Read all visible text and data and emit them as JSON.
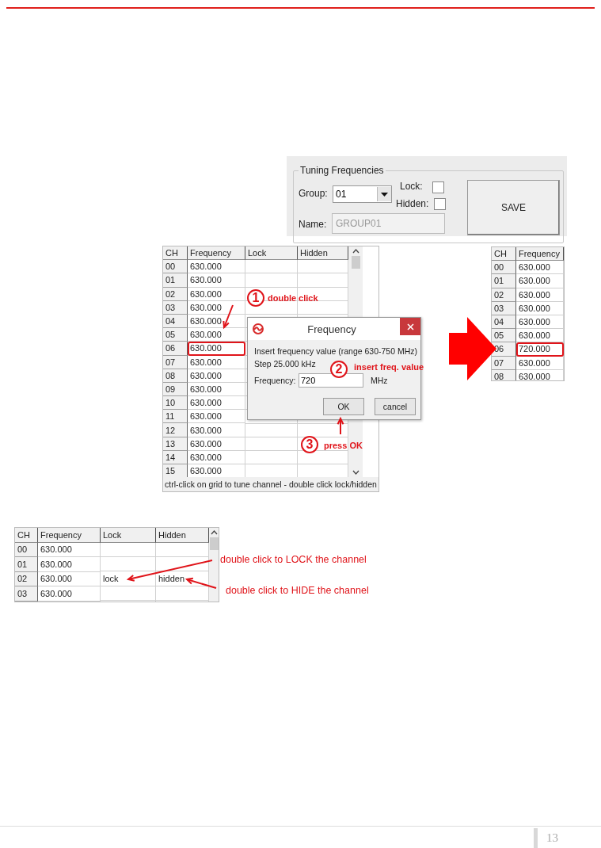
{
  "settings_panel": {
    "title": "Tuning Frequencies",
    "group_label": "Group:",
    "group_value": "01",
    "lock_label": "Lock:",
    "lock_checked": false,
    "hidden_label": "Hidden:",
    "hidden_checked": false,
    "name_label": "Name:",
    "name_value": "GROUP01",
    "save_button": "SAVE"
  },
  "channel_grid": {
    "columns": [
      "CH",
      "Frequency",
      "Lock",
      "Hidden"
    ],
    "rows": [
      {
        "ch": "00",
        "frequency": "630.000",
        "highlighted": false
      },
      {
        "ch": "01",
        "frequency": "630.000",
        "highlighted": false
      },
      {
        "ch": "02",
        "frequency": "630.000",
        "highlighted": false
      },
      {
        "ch": "03",
        "frequency": "630.000",
        "highlighted": false
      },
      {
        "ch": "04",
        "frequency": "630.000",
        "highlighted": false
      },
      {
        "ch": "05",
        "frequency": "630.000",
        "highlighted": false
      },
      {
        "ch": "06",
        "frequency": "630.000",
        "highlighted": true
      },
      {
        "ch": "07",
        "frequency": "630.000",
        "highlighted": false
      },
      {
        "ch": "08",
        "frequency": "630.000",
        "highlighted": false
      },
      {
        "ch": "09",
        "frequency": "630.000",
        "highlighted": false
      },
      {
        "ch": "10",
        "frequency": "630.000",
        "highlighted": false
      },
      {
        "ch": "11",
        "frequency": "630.000",
        "highlighted": false
      },
      {
        "ch": "12",
        "frequency": "630.000",
        "highlighted": false
      },
      {
        "ch": "13",
        "frequency": "630.000",
        "highlighted": false
      },
      {
        "ch": "14",
        "frequency": "630.000",
        "highlighted": false
      },
      {
        "ch": "15",
        "frequency": "630.000",
        "highlighted": false
      }
    ],
    "status": "ctrl-click on grid to tune channel - double click lock/hidden"
  },
  "dialog": {
    "title": "Frequency",
    "prompt": "Insert frequency value (range 630-750 MHz)",
    "step": "Step 25.000 kHz",
    "field_label": "Frequency:",
    "field_value": "720",
    "unit": "MHz",
    "buttons": [
      "OK",
      "cancel"
    ]
  },
  "steps": [
    {
      "number": "1",
      "text": "double click"
    },
    {
      "number": "2",
      "text": "insert freq. value"
    },
    {
      "number": "3",
      "text": "press OK"
    }
  ],
  "result_grid": {
    "columns": [
      "CH",
      "Frequency"
    ],
    "rows": [
      {
        "ch": "00",
        "frequency": "630.000",
        "highlighted": false
      },
      {
        "ch": "01",
        "frequency": "630.000",
        "highlighted": false
      },
      {
        "ch": "02",
        "frequency": "630.000",
        "highlighted": false
      },
      {
        "ch": "03",
        "frequency": "630.000",
        "highlighted": false
      },
      {
        "ch": "04",
        "frequency": "630.000",
        "highlighted": false
      },
      {
        "ch": "05",
        "frequency": "630.000",
        "highlighted": false
      },
      {
        "ch": "06",
        "frequency": "720.000",
        "highlighted": true
      },
      {
        "ch": "07",
        "frequency": "630.000",
        "highlighted": false
      },
      {
        "ch": "08",
        "frequency": "630.000",
        "highlighted": false
      }
    ]
  },
  "example_grid": {
    "columns": [
      "CH",
      "Frequency",
      "Lock",
      "Hidden"
    ],
    "rows": [
      {
        "ch": "00",
        "frequency": "630.000"
      },
      {
        "ch": "01",
        "frequency": "630.000"
      },
      {
        "ch": "02",
        "frequency": "630.000",
        "lock": "lock",
        "hidden": "hidden"
      },
      {
        "ch": "03",
        "frequency": "630.000"
      }
    ]
  },
  "notes": [
    "double click to LOCK the channel",
    "double click to HIDE the channel"
  ],
  "page_number": "13"
}
